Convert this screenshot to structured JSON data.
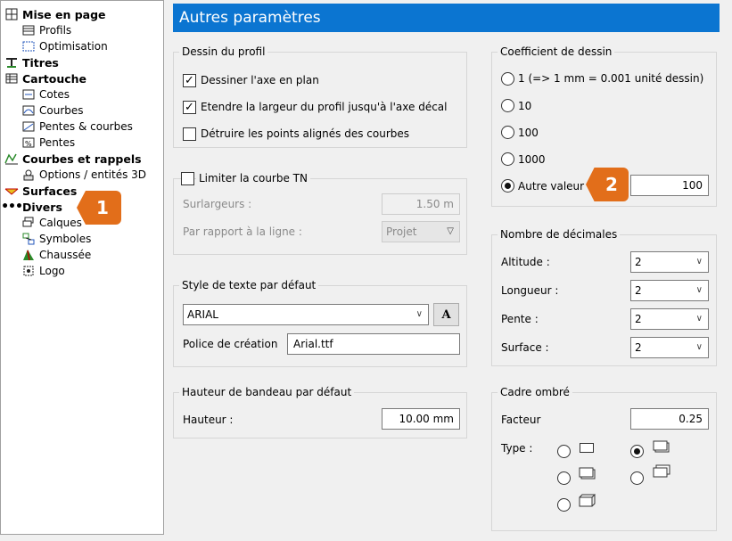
{
  "sidebar": {
    "items": [
      {
        "label": "Mise en page",
        "icon": "layout-grid-icon"
      },
      {
        "label": "Profils",
        "icon": "profile-table-icon"
      },
      {
        "label": "Optimisation",
        "icon": "optimisation-icon"
      },
      {
        "label": "Titres",
        "icon": "titles-icon"
      },
      {
        "label": "Cartouche",
        "icon": "cartouche-icon"
      },
      {
        "label": "Cotes",
        "icon": "cotes-icon"
      },
      {
        "label": "Courbes",
        "icon": "curves-icon"
      },
      {
        "label": "Pentes & courbes",
        "icon": "slopes-curves-icon"
      },
      {
        "label": "Pentes",
        "icon": "slopes-icon"
      },
      {
        "label": "Courbes et rappels",
        "icon": "curves-recall-icon"
      },
      {
        "label": "Options / entités 3D",
        "icon": "3d-options-icon"
      },
      {
        "label": "Surfaces",
        "icon": "surfaces-icon"
      },
      {
        "label": "Divers",
        "icon": "dots-icon"
      },
      {
        "label": "Calques",
        "icon": "layers-icon"
      },
      {
        "label": "Symboles",
        "icon": "symbols-icon"
      },
      {
        "label": "Chaussée",
        "icon": "road-icon"
      },
      {
        "label": "Logo",
        "icon": "logo-icon"
      }
    ]
  },
  "header": {
    "title": "Autres paramètres"
  },
  "badges": {
    "one": "1",
    "two": "2",
    "color": "#e26e1a"
  },
  "dessin_profil": {
    "title": "Dessin du profil",
    "opt1": "Dessiner l'axe en plan",
    "opt2": "Etendre la largeur du profil jusqu'à l'axe décal",
    "opt3": "Détruire les points alignés des courbes"
  },
  "courbe_tn": {
    "title": "Limiter la courbe TN",
    "surlargeurs_label": "Surlargeurs :",
    "surlargeurs_value": "1.50 m",
    "ligne_label": "Par rapport à la ligne :",
    "ligne_value": "Projet"
  },
  "style_texte": {
    "title": "Style de texte par défaut",
    "font_value": "ARIAL",
    "font_button": "A",
    "police_label": "Police de création",
    "police_value": "Arial.ttf"
  },
  "hauteur_bandeau": {
    "title": "Hauteur de bandeau par défaut",
    "label": "Hauteur :",
    "value": "10.00 mm"
  },
  "coefficient": {
    "title": "Coefficient de dessin",
    "opt1": "1  (=> 1 mm = 0.001 unité dessin)",
    "opt10": "10",
    "opt100": "100",
    "opt1000": "1000",
    "opt_autre": "Autre valeur",
    "autre_value": "100"
  },
  "decimales": {
    "title": "Nombre de décimales",
    "altitude_label": "Altitude :",
    "altitude_value": "2",
    "longueur_label": "Longueur :",
    "longueur_value": "2",
    "pente_label": "Pente :",
    "pente_value": "2",
    "surface_label": "Surface :",
    "surface_value": "2"
  },
  "cadre": {
    "title": "Cadre ombré",
    "facteur_label": "Facteur",
    "facteur_value": "0.25",
    "type_label": "Type :"
  }
}
